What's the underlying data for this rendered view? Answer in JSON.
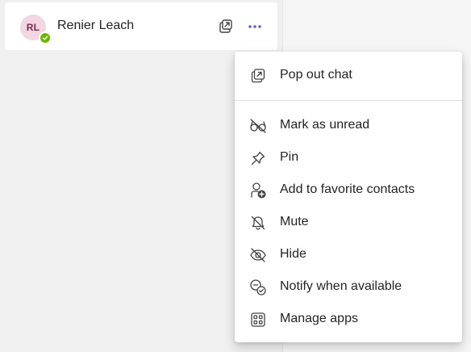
{
  "chat": {
    "name": "Renier Leach",
    "initials": "RL",
    "presence": "available",
    "avatar_bg": "#f3d6e2",
    "presence_color": "#6bb700"
  },
  "menu": {
    "items": [
      {
        "label": "Pop out chat",
        "icon": "pop-out-icon"
      },
      {
        "label": "Mark as unread",
        "icon": "glasses-off-icon"
      },
      {
        "label": "Pin",
        "icon": "pin-icon"
      },
      {
        "label": "Add to favorite contacts",
        "icon": "person-add-icon"
      },
      {
        "label": "Mute",
        "icon": "bell-off-icon"
      },
      {
        "label": "Hide",
        "icon": "eye-off-icon"
      },
      {
        "label": "Notify when available",
        "icon": "presence-notify-icon"
      },
      {
        "label": "Manage apps",
        "icon": "apps-grid-icon"
      }
    ]
  },
  "accent_color": "#5b5fc7"
}
